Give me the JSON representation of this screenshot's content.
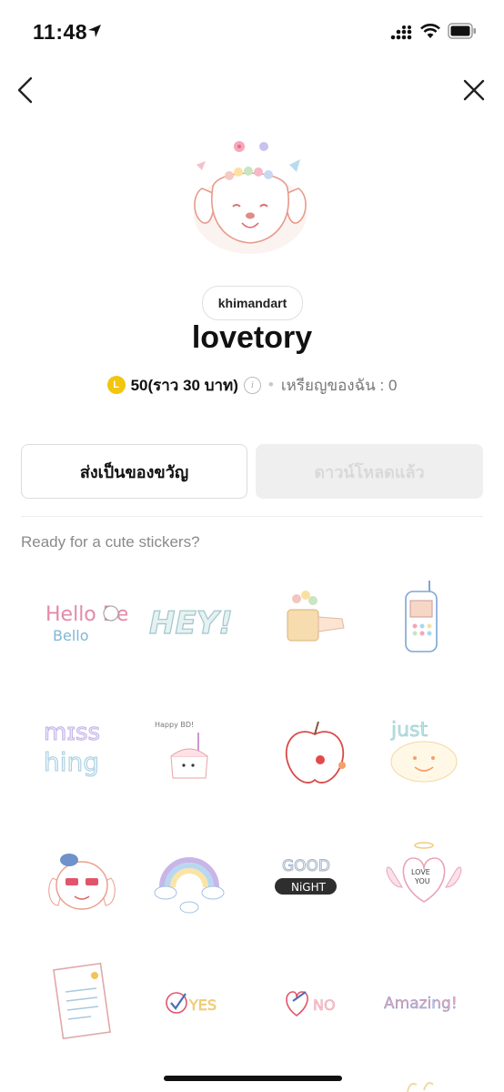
{
  "status_bar": {
    "time": "11:48"
  },
  "creator": "khimandart",
  "title": "lovetory",
  "price": {
    "coin_symbol": "L",
    "amount": "50(ราว 30 บาท)",
    "my_coins": "เหรียญของฉัน : 0"
  },
  "buttons": {
    "gift": "ส่งเป็นของขวัญ",
    "downloaded": "ดาวน์โหลดแล้ว"
  },
  "description": "Ready for a cute stickers?",
  "stickers": [
    {
      "name": "hello-bello-sticker",
      "text": "Hello Bello"
    },
    {
      "name": "hey-sticker",
      "text": "HEY!"
    },
    {
      "name": "coffee-mug-sticker",
      "text": ""
    },
    {
      "name": "phone-sticker",
      "text": ""
    },
    {
      "name": "missing-sticker",
      "text": "miss ing"
    },
    {
      "name": "birthday-cake-sticker",
      "text": "Happy BD!"
    },
    {
      "name": "apple-sticker",
      "text": ""
    },
    {
      "name": "just-smile-sticker",
      "text": "just"
    },
    {
      "name": "puppy-sunglasses-sticker",
      "text": ""
    },
    {
      "name": "rainbow-sticker",
      "text": ""
    },
    {
      "name": "good-night-sticker",
      "text": "GOOD NiGHT"
    },
    {
      "name": "love-you-heart-sticker",
      "text": "LOVE YOU :-)"
    },
    {
      "name": "letter-sticker",
      "text": ""
    },
    {
      "name": "yes-sticker",
      "text": "YES"
    },
    {
      "name": "no-sticker",
      "text": "NO"
    },
    {
      "name": "amazing-sticker",
      "text": "Amazing!"
    }
  ],
  "colors": {
    "coin": "#f2c50f",
    "accent_text": "#111111",
    "muted": "#8a8a8a"
  }
}
